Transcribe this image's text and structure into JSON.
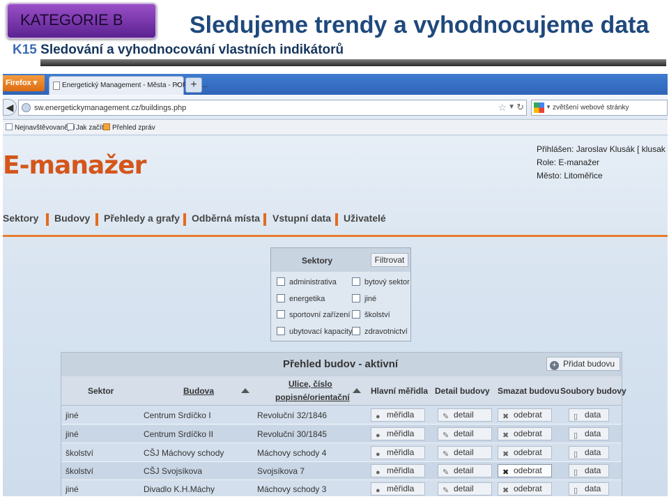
{
  "slide": {
    "category": "KATEGORIE B",
    "title": "Sledujeme trendy a vyhodnocujeme data",
    "code": "K15",
    "subtitle": "Sledování a vyhodnocování vlastních indikátorů"
  },
  "browser": {
    "firefox_button": "Firefox ▾",
    "tab_title": "Energetický Management - Města - PORSEN...",
    "tab_close": "×",
    "new_tab": "+",
    "url": "sw.energetickymanagement.cz/buildings.php",
    "search_value": "zvětšení webové stránky",
    "bookmarks": [
      "Nejnavštěvovanější",
      "Jak začít",
      "Přehled zpráv"
    ]
  },
  "site": {
    "logo": "E-manažer",
    "user": {
      "logged_in": "Přihlášen: Jaroslav Klusák [ klusak ]",
      "role": "Role: E-manažer",
      "city": "Město: Litoměřice"
    },
    "nav": [
      "Sektory",
      "Budovy",
      "Přehledy a grafy",
      "Odběrná místa",
      "Vstupní data",
      "Uživatelé"
    ],
    "filter": {
      "title": "Sektory",
      "button": "Filtrovat",
      "options": [
        "administrativa",
        "bytový sektor",
        "energetika",
        "jiné",
        "sportovní zařízení",
        "školství",
        "ubytovací kapacity",
        "zdravotnictví"
      ]
    },
    "table": {
      "title": "Přehled budov - aktivní",
      "add_button": "Přidat budovu",
      "columns": {
        "sector": "Sektor",
        "building": "Budova",
        "street_1": "Ulice, číslo",
        "street_2": "popisné/orientační",
        "meters": "Hlavní měřidla",
        "detail": "Detail budovy",
        "delete": "Smazat budovu",
        "files": "Soubory budovy"
      },
      "actions": {
        "meters": "měřidla",
        "detail": "detail",
        "delete": "odebrat",
        "files": "data"
      },
      "rows": [
        {
          "sector": "jiné",
          "building": "Centrum Srdíčko I",
          "address": "Revoluční 32/1846"
        },
        {
          "sector": "jiné",
          "building": "Centrum Srdíčko II",
          "address": "Revoluční 30/1845"
        },
        {
          "sector": "školství",
          "building": "CŠJ Máchovy schody",
          "address": "Máchovy schody 4"
        },
        {
          "sector": "školství",
          "building": "CŠJ Svojsíkova",
          "address": "Svojsíkova 7"
        },
        {
          "sector": "jiné",
          "building": "Divadlo K.H.Máchy",
          "address": "Máchovy schody 3"
        }
      ]
    }
  }
}
